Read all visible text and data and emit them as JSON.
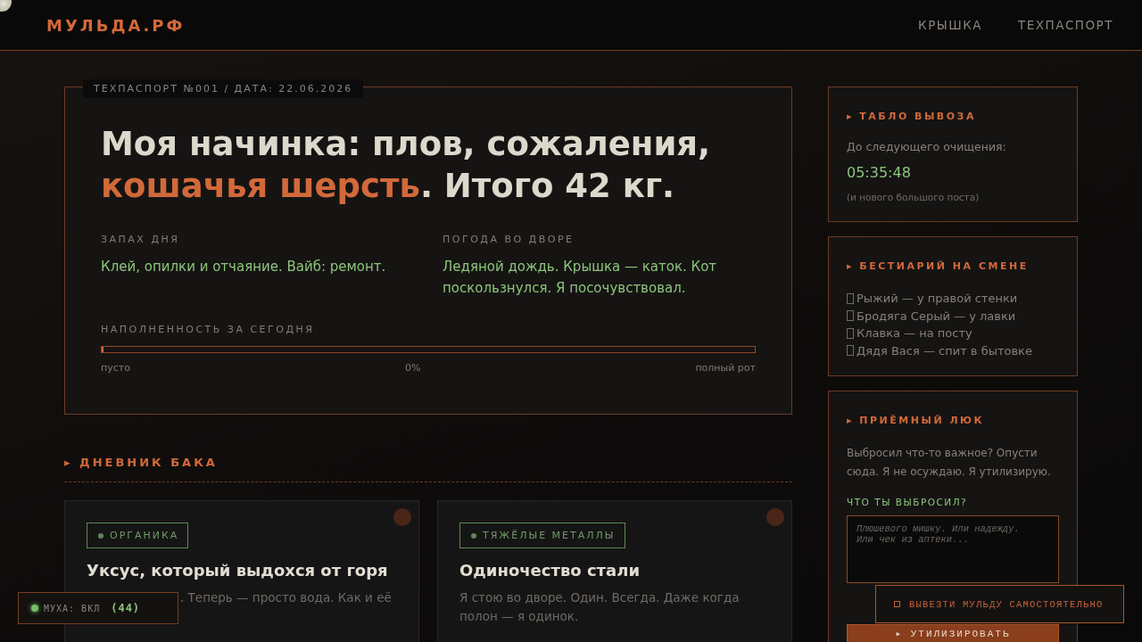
{
  "header": {
    "logo": "МУЛЬДА.РФ",
    "nav": [
      {
        "label": "КРЫШКА"
      },
      {
        "label": "ТЕХПАСПОРТ"
      }
    ]
  },
  "passport": {
    "tab": "ТЕХПАСПОРТ №001 / ДАТА: 22.06.2026",
    "headline": [
      {
        "text": "Моя начинка: плов, сожаления, ",
        "accent": false
      },
      {
        "text": "кошачья шерсть",
        "accent": true
      },
      {
        "text": ". Итого 42 кг.",
        "accent": false
      }
    ],
    "facts": [
      {
        "label": "ЗАПАХ ДНЯ",
        "value": "Клей, опилки и отчаяние. Вайб: ремонт."
      },
      {
        "label": "ПОГОДА ВО ДВОРЕ",
        "value": "Ледяной дождь. Крышка — каток. Кот поскользнулся. Я посочувствовал."
      }
    ],
    "fill": {
      "label": "НАПОЛНЕННОСТЬ ЗА СЕГОДНЯ",
      "level": 0,
      "min_label": "пусто",
      "reading": "0%",
      "max_label": "полный рот"
    }
  },
  "diary": {
    "title": "▸ ДНЕВНИК БАКА",
    "entries": [
      {
        "tag": "ОРГАНИКА",
        "title": "Уксус, который выдохся от горя",
        "text": ". Теперь — просто вода. Как и её",
        "covered": true
      },
      {
        "tag": "ТЯЖЁЛЫЕ МЕТАЛЛЫ",
        "title": "Одиночество стали",
        "text": "Я стою во дворе. Один. Всегда. Даже когда полон — я одинок.",
        "covered": false
      }
    ]
  },
  "schedule": {
    "title": "▸ ТАБЛО ВЫВОЗА",
    "caption": "До следующего очищения:",
    "time": "05:35:48",
    "note": "(и нового большого поста)"
  },
  "bestiary": {
    "title": "▸ БЕСТИАРИЙ НА СМЕНЕ",
    "items": [
      "Рыжий — у правой стенки",
      "Бродяга Серый — у лавки",
      "Клавка — на посту",
      "Дядя Вася — спит в бытовке"
    ]
  },
  "hatch": {
    "title": "▸ ПРИЁМНЫЙ ЛЮК",
    "text": "Выбросил что-то важное? Опусти сюда. Я не осуждаю. Я утилизирую.",
    "field_label": "ЧТО ТЫ ВЫБРОСИЛ?",
    "placeholder": "Плюшевого мишку. Или надежду.\nИли чек из аптеки...",
    "submit": "▸ УТИЛИЗИРОВАТЬ"
  },
  "fly": {
    "label": "МУХА: ВКЛ",
    "count": "(44)",
    "on": true
  },
  "float_button": {
    "label": "ВЫВЕЗТИ МУЛЬДУ САМОСТОЯТЕЛЬНО"
  }
}
